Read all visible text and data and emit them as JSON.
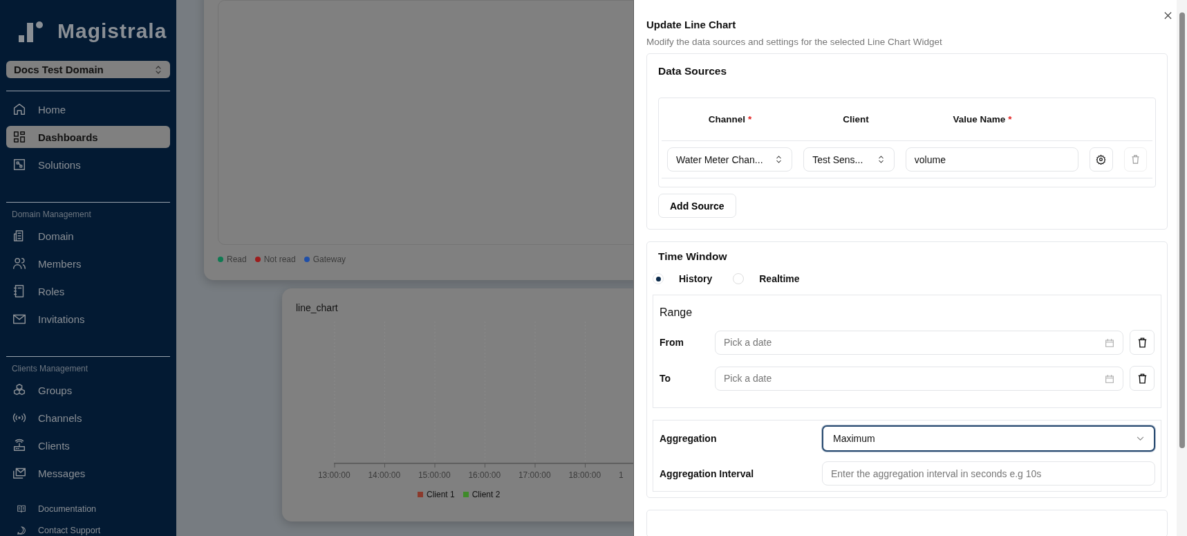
{
  "sidebar": {
    "brand": "Magistrala",
    "domain_selector": {
      "value": "Docs Test Domain"
    },
    "sections": [
      {
        "items": [
          {
            "label": "Home",
            "selected": false
          },
          {
            "label": "Dashboards",
            "selected": true
          },
          {
            "label": "Solutions",
            "selected": false
          }
        ]
      },
      {
        "heading": "Domain Management",
        "items": [
          {
            "label": "Domain",
            "selected": false
          },
          {
            "label": "Members",
            "selected": false
          },
          {
            "label": "Roles",
            "selected": false
          },
          {
            "label": "Invitations",
            "selected": false
          }
        ]
      },
      {
        "heading": "Clients Management",
        "items": [
          {
            "label": "Groups",
            "selected": false
          },
          {
            "label": "Channels",
            "selected": false
          },
          {
            "label": "Clients",
            "selected": false
          },
          {
            "label": "Messages",
            "selected": false
          }
        ]
      }
    ],
    "footer_links": [
      "Documentation",
      "Contact Support"
    ]
  },
  "dashboard": {
    "status_legend": [
      {
        "label": "Read",
        "color": "#0f7a52"
      },
      {
        "label": "Not read",
        "color": "#9c1c1c"
      },
      {
        "label": "Gateway",
        "color": "#1f4fa8"
      }
    ],
    "line_chart": {
      "title": "line_chart",
      "x_ticks": [
        "13:00:00",
        "14:00:00",
        "15:00:00",
        "16:00:00",
        "17:00:00",
        "18:00:00",
        "1"
      ],
      "legend": [
        {
          "label": "Client 1",
          "color": "#8b3a2c"
        },
        {
          "label": "Client 2",
          "color": "#3f8a2a"
        }
      ]
    }
  },
  "dialog": {
    "title": "Update Line Chart",
    "description": "Modify the data sources and settings for the selected Line Chart Widget",
    "data_sources": {
      "title": "Data Sources",
      "columns": [
        {
          "label": "Channel",
          "marker": "*"
        },
        {
          "label": "Client"
        },
        {
          "label": "Value Name",
          "marker": "*"
        }
      ],
      "rows": [
        {
          "channel": "Water Meter Chan...",
          "client": "Test Sens...",
          "value_name": "volume",
          "remove_disabled": true
        }
      ],
      "add_button": "Add Source"
    },
    "time_window": {
      "title": "Time Window",
      "modes": [
        {
          "label": "History",
          "selected": true
        },
        {
          "label": "Realtime",
          "selected": false
        }
      ],
      "range": {
        "title": "Range",
        "fields": [
          {
            "label": "From",
            "placeholder": "Pick a date"
          },
          {
            "label": "To",
            "placeholder": "Pick a date"
          }
        ]
      },
      "aggregation": {
        "label": "Aggregation",
        "value": "Maximum",
        "focused": true
      },
      "interval": {
        "label": "Aggregation Interval",
        "placeholder": "Enter the aggregation interval in seconds e.g 10s"
      }
    }
  }
}
